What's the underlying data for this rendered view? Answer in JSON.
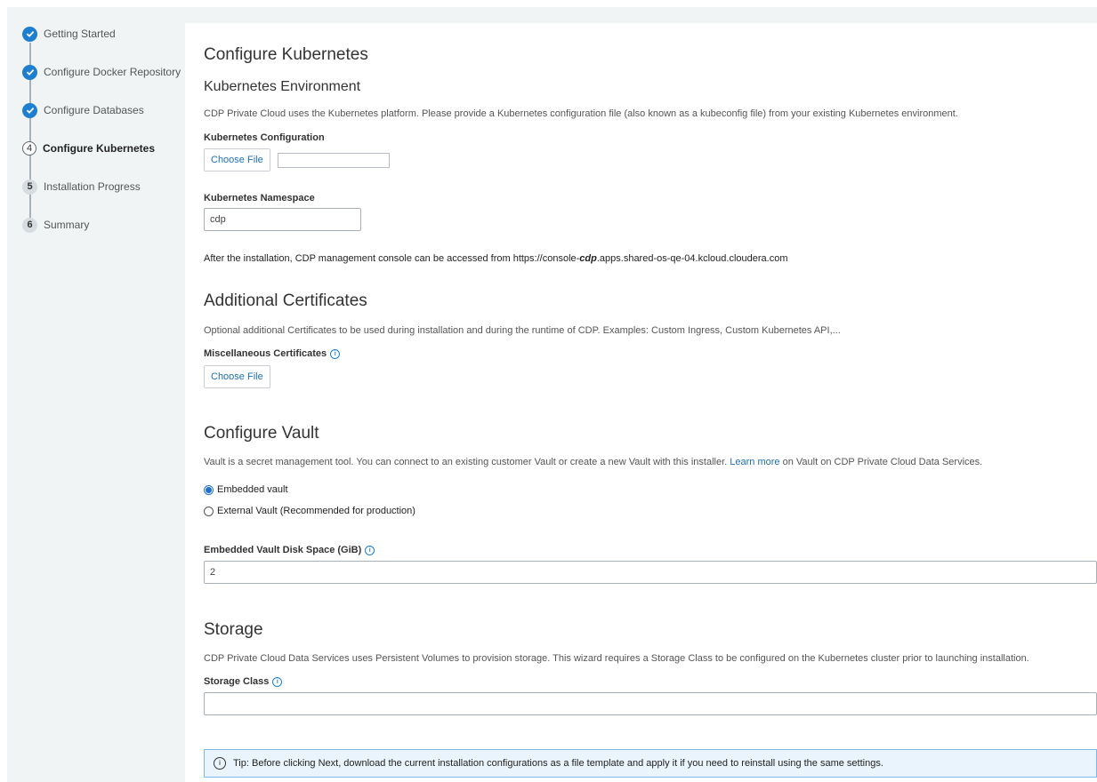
{
  "sidebar": {
    "steps": [
      {
        "label": "Getting Started",
        "marker": "check-icon"
      },
      {
        "label": "Configure Docker Repository",
        "marker": "check-icon"
      },
      {
        "label": "Configure Databases",
        "marker": "check-icon"
      },
      {
        "label": "Configure Kubernetes",
        "marker": "4"
      },
      {
        "label": "Installation Progress",
        "marker": "5"
      },
      {
        "label": "Summary",
        "marker": "6"
      }
    ]
  },
  "page": {
    "title": "Configure Kubernetes",
    "k8s_env": {
      "heading": "Kubernetes Environment",
      "description": "CDP Private Cloud uses the Kubernetes platform. Please provide a Kubernetes configuration file (also known as a kubeconfig file) from your existing Kubernetes environment.",
      "config_label": "Kubernetes Configuration",
      "choose_file": "Choose File",
      "namespace_label": "Kubernetes Namespace",
      "namespace_value": "cdp",
      "console_prefix": "After the installation, CDP management console can be accessed from https://console-",
      "console_ns": "cdp",
      "console_suffix": ".apps.shared-os-qe-04.kcloud.cloudera.com"
    },
    "certs": {
      "heading": "Additional Certificates",
      "description": "Optional additional Certificates to be used during installation and during the runtime of CDP. Examples: Custom Ingress, Custom Kubernetes API,...",
      "misc_label": "Miscellaneous Certificates",
      "choose_file": "Choose File"
    },
    "vault": {
      "heading": "Configure Vault",
      "desc_before": "Vault is a secret management tool. You can connect to an existing customer Vault or create a new Vault with this installer.",
      "learn_more": "Learn more",
      "desc_after": "on Vault on CDP Private Cloud Data Services.",
      "option_embedded": "Embedded vault",
      "option_external": "External Vault (Recommended for production)",
      "selected": "Embedded vault",
      "disk_label": "Embedded Vault Disk Space (GiB)",
      "disk_value": "2"
    },
    "storage": {
      "heading": "Storage",
      "description": "CDP Private Cloud Data Services uses Persistent Volumes to provision storage. This wizard requires a Storage Class to be configured on the Kubernetes cluster prior to launching installation.",
      "class_label": "Storage Class",
      "class_value": ""
    },
    "tip": "Tip: Before clicking Next, download the current installation configurations as a file template and apply it if you need to reinstall using the same settings."
  },
  "colors": {
    "accent": "#1e7fd0",
    "sidebar_bg": "#f1f4f5",
    "tip_bg": "#eaf4fc",
    "tip_border": "#7db8e8"
  }
}
